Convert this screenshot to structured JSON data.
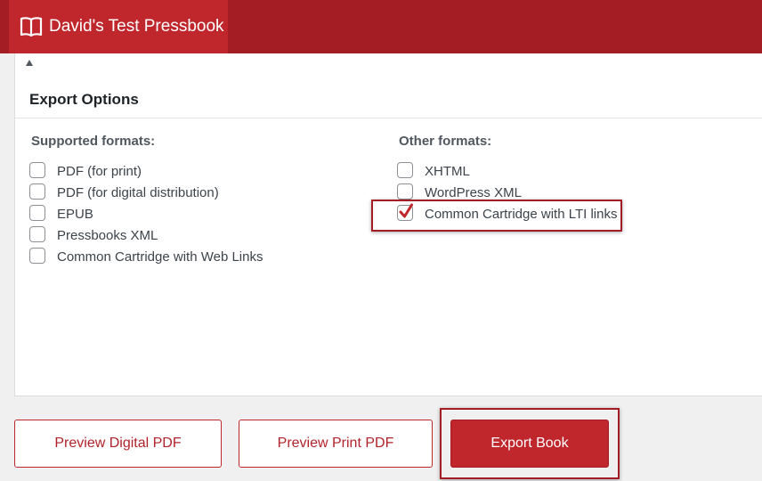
{
  "header": {
    "title": "David's Test Pressbook",
    "icon": "book-icon"
  },
  "panel": {
    "title": "Export Options",
    "collapse_icon": "collapse-arrow-icon",
    "supported": {
      "heading": "Supported formats:",
      "options": [
        {
          "label": "PDF (for print)",
          "checked": false
        },
        {
          "label": "PDF (for digital distribution)",
          "checked": false
        },
        {
          "label": "EPUB",
          "checked": false
        },
        {
          "label": "Pressbooks XML",
          "checked": false
        },
        {
          "label": "Common Cartridge with Web Links",
          "checked": false
        }
      ]
    },
    "other": {
      "heading": "Other formats:",
      "options": [
        {
          "label": "XHTML",
          "checked": false
        },
        {
          "label": "WordPress XML",
          "checked": false
        },
        {
          "label": "Common Cartridge with LTI links",
          "checked": true
        }
      ]
    }
  },
  "buttons": {
    "preview_digital": "Preview Digital PDF",
    "preview_print": "Preview Print PDF",
    "export": "Export Book"
  },
  "colors": {
    "brand": "#a51d24",
    "brand_light": "#c0272d",
    "check": "#c0272d"
  }
}
